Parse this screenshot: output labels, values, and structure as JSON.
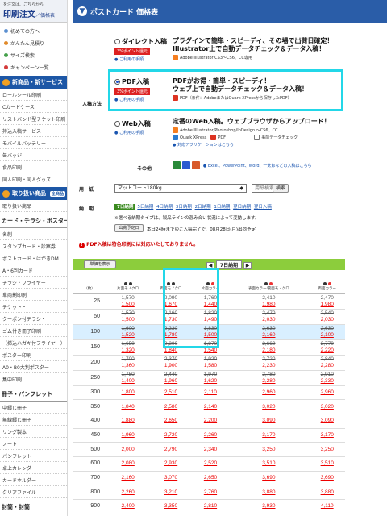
{
  "sidebar": {
    "tagline": "を注文は、こちらから",
    "logo": "印刷注文",
    "logo_sub": "価格表",
    "links": [
      {
        "label": "初めての方へ",
        "icon": "info-icon",
        "color": "#5a8fd0"
      },
      {
        "label": "かんたん見積り",
        "icon": "calculator-icon",
        "color": "#e08a2a"
      },
      {
        "label": "サイズ検索",
        "icon": "size-search-icon",
        "color": "#45a04a"
      },
      {
        "label": "キャンペーン一覧",
        "icon": "campaign-icon",
        "color": "#d33a3a"
      }
    ],
    "new_section": {
      "label": "新商品・新サービス"
    },
    "new_items": [
      "ロールシール印刷",
      "Cカードケース",
      "リストバンド型チケット印刷",
      "持込入稿サービス",
      "モバイルバッテリー",
      "缶バッジ",
      "食品印刷",
      "同人印刷・同人グッズ"
    ],
    "products_section": {
      "label": "取り扱い商品",
      "tag": "全商品"
    },
    "products_link": "取り扱い商品",
    "cat1": "カード・チラシ・ポスター",
    "cat1_items": [
      "名刺",
      "スタンプカード・診察券",
      "ポストカード・はがきDM",
      "A・6判カード",
      "チラシ・フライヤー",
      "車両割印刷",
      "チケット・",
      "クーポン付チラシ・",
      "ゴム付き冊子印刷",
      "（挿込ハガキ付フライヤー）",
      "ポスター印刷",
      "A0・B0大判ポスター",
      "集中印刷"
    ],
    "cat2": "冊子・パンフレット",
    "cat2_items": [
      "中綴じ冊子",
      "無線綴じ冊子",
      "リング製本",
      "ノート",
      "パンフレット",
      "卓上カレンダー",
      "カードホルダー",
      "クリアファイル"
    ],
    "cat3": "封筒・封筒"
  },
  "main": {
    "title": "ポストカード 価格表",
    "title_icon": "down-arrow-icon",
    "options_label": "入稿方法",
    "opt_direct": {
      "name": "ダイレクト入稿",
      "badge": "3%ポイント還元",
      "link": "ご利用の手順",
      "desc1": "プラグインで簡単・スピーディ、その場で出荷日確定！",
      "desc2": "Illustrator上で自動データチェック＆データ入稿！",
      "note": "Adobe Illustrator  CS3〜CS6、CC専用"
    },
    "opt_pdf": {
      "name": "PDF入稿",
      "badge": "3%ポイント還元",
      "link": "ご利用の手順",
      "desc1": "PDFがお得・簡単・スピーディ！",
      "desc2": "ウェブ上で自動データチェック＆データ入稿！",
      "note": "PDF（条件：AdobeまたはQuark XPressから保存したPDF）"
    },
    "opt_web": {
      "name": "Web入稿",
      "link": "ご利用の手順",
      "desc1": "定番のWeb入稿。ウェブブラウザからアップロード！",
      "note1": "Adobe Illustrator/Photoshop/InDesign  〜CS6、CC",
      "note2": "Quark XPress",
      "note3": "PDF",
      "check": "事前データチェック",
      "apps_link": "対応アプリケーションはこちら"
    },
    "other_label": "その他",
    "other_desc": "Excel、PowerPoint、Word、一太郎などの入稿はこちら",
    "paper_label": "用　紙",
    "paper_value": "マットコート180kg",
    "paper_search_placeholder": "用紙検索",
    "paper_search_btn": "検索",
    "delivery_label": "納　期",
    "delivery_tabs": [
      "7日納期",
      "5日納期",
      "4日納期",
      "3日納期",
      "2日納期",
      "1日納期",
      "翌日納期",
      "翌日入稿"
    ],
    "delivery_note": "※選べる納期タイプは、製品ラインの混み合い状況によって変動します。",
    "shipping_btn": "出荷予定日",
    "shipping_note": "本日24時までのご入稿完了で、08月28日(月)出荷予定",
    "warning": "PDF入稿は特色印刷には対応いたしておりません。",
    "table_btn": "単価を表示",
    "table_nav": "7日納期",
    "columns": [
      "（枚）",
      "片面モノクロ",
      "両面モノクロ",
      "片面カラー",
      "表面カラー/裏面モノクロ",
      "両面カラー"
    ],
    "rows": [
      {
        "qty": "25",
        "cells": [
          [
            "1,570",
            "1,500"
          ],
          [
            "2,090",
            "1,670"
          ],
          [
            "1,760",
            "1,440"
          ],
          [
            "2,410",
            "1,980"
          ],
          [
            "2,470",
            "1,980"
          ]
        ]
      },
      {
        "qty": "50",
        "cells": [
          [
            "1,570",
            "1,500"
          ],
          [
            "2,160",
            "1,730"
          ],
          [
            "1,820",
            "1,490"
          ],
          [
            "2,470",
            "2,030"
          ],
          [
            "2,540",
            "2,030"
          ]
        ]
      },
      {
        "qty": "100",
        "cells": [
          [
            "1,600",
            "1,520"
          ],
          [
            "2,230",
            "1,780"
          ],
          [
            "1,830",
            "1,500"
          ],
          [
            "2,630",
            "2,160"
          ],
          [
            "2,630",
            "2,100"
          ]
        ]
      },
      {
        "qty": "150",
        "cells": [
          [
            "1,650",
            "1,320"
          ],
          [
            "2,300",
            "1,840"
          ],
          [
            "1,870",
            "1,540"
          ],
          [
            "2,660",
            "2,180"
          ],
          [
            "2,770",
            "2,220"
          ]
        ]
      },
      {
        "qty": "200",
        "cells": [
          [
            "1,700",
            "1,360"
          ],
          [
            "2,370",
            "1,900"
          ],
          [
            "1,920",
            "1,580"
          ],
          [
            "2,720",
            "2,230"
          ],
          [
            "2,840",
            "2,280"
          ]
        ]
      },
      {
        "qty": "250",
        "cells": [
          [
            "1,750",
            "1,400"
          ],
          [
            "2,440",
            "1,960"
          ],
          [
            "1,970",
            "1,620"
          ],
          [
            "2,780",
            "2,280"
          ],
          [
            "2,910",
            "2,330"
          ]
        ]
      },
      {
        "qty": "300",
        "cells": [
          [
            "1,800"
          ],
          [
            "2,510"
          ],
          [
            "2,110"
          ],
          [
            "2,960"
          ],
          [
            "2,960"
          ]
        ]
      },
      {
        "qty": "350",
        "cells": [
          [
            "1,840"
          ],
          [
            "2,580"
          ],
          [
            "2,140"
          ],
          [
            "3,020"
          ],
          [
            "3,020"
          ]
        ]
      },
      {
        "qty": "400",
        "cells": [
          [
            "1,880"
          ],
          [
            "2,650"
          ],
          [
            "2,200"
          ],
          [
            "3,090"
          ],
          [
            "3,090"
          ]
        ]
      },
      {
        "qty": "450",
        "cells": [
          [
            "1,960"
          ],
          [
            "2,720"
          ],
          [
            "2,260"
          ],
          [
            "3,170"
          ],
          [
            "3,170"
          ]
        ]
      },
      {
        "qty": "500",
        "cells": [
          [
            "2,000"
          ],
          [
            "2,790"
          ],
          [
            "2,340"
          ],
          [
            "3,250"
          ],
          [
            "3,250"
          ]
        ]
      },
      {
        "qty": "600",
        "cells": [
          [
            "2,080"
          ],
          [
            "2,930"
          ],
          [
            "2,520"
          ],
          [
            "3,510"
          ],
          [
            "3,510"
          ]
        ]
      },
      {
        "qty": "700",
        "cells": [
          [
            "2,160"
          ],
          [
            "3,070"
          ],
          [
            "2,650"
          ],
          [
            "3,690"
          ],
          [
            "3,690"
          ]
        ]
      },
      {
        "qty": "800",
        "cells": [
          [
            "2,260"
          ],
          [
            "3,210"
          ],
          [
            "2,760"
          ],
          [
            "3,880"
          ],
          [
            "3,880"
          ]
        ]
      },
      {
        "qty": "900",
        "cells": [
          [
            "2,400"
          ],
          [
            "3,350"
          ],
          [
            "2,810"
          ],
          [
            "3,930"
          ],
          [
            "4,110"
          ]
        ]
      },
      {
        "qty": "1000",
        "cells": [
          [
            "2,500"
          ],
          [
            "3,490"
          ],
          [
            "2,930"
          ],
          [
            "3,970"
          ],
          [
            "4,110"
          ]
        ]
      }
    ],
    "highlight_row": "100",
    "colors": {
      "accent": "#23d7e8",
      "header_blue": "#2a5da8",
      "table_green": "#8ccd3c",
      "price_red": "#e00"
    }
  }
}
